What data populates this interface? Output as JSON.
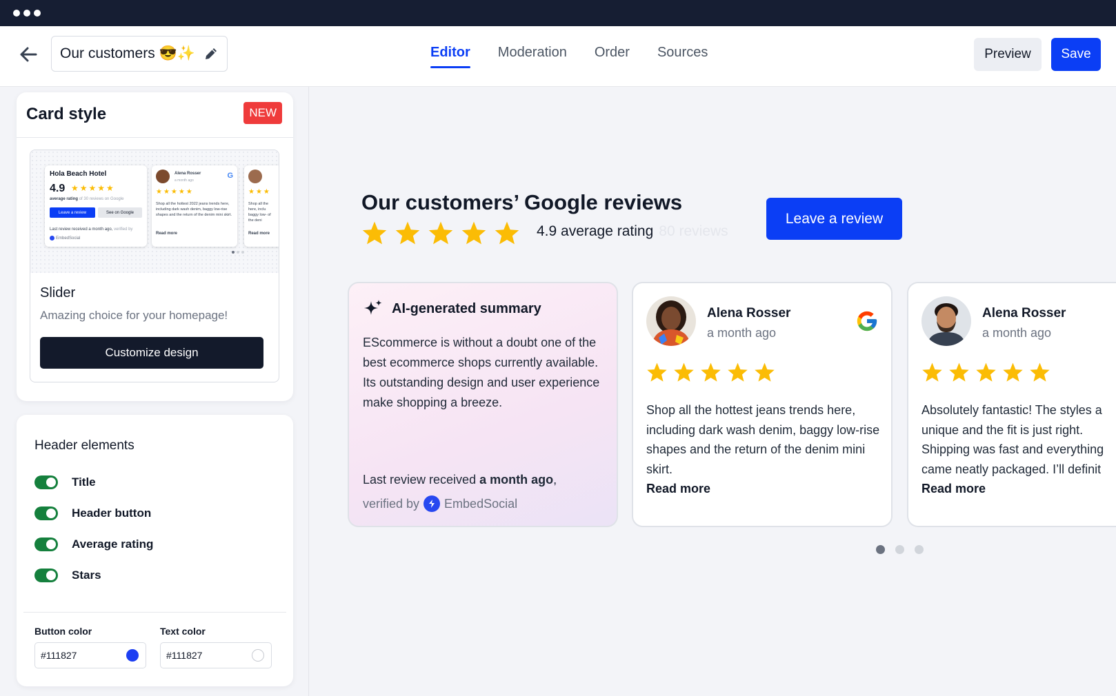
{
  "window": {
    "title_dots": 3
  },
  "topbar": {
    "back_label": "Back",
    "widget_name": "Our customers 😎✨",
    "tabs": [
      {
        "label": "Editor",
        "active": true
      },
      {
        "label": "Moderation",
        "active": false
      },
      {
        "label": "Order",
        "active": false
      },
      {
        "label": "Sources",
        "active": false
      }
    ],
    "preview_label": "Preview",
    "save_label": "Save"
  },
  "sidebar": {
    "card_style": {
      "heading": "Card style",
      "badge": "NEW",
      "thumbnail": {
        "hotel_name": "Hola Beach Hotel",
        "rating": "4.9",
        "rating_caption": "average rating",
        "rating_sub": "of 30 reviews on Google",
        "leave_btn": "Leave a review",
        "see_btn": "See on Google",
        "last_review": "Last review received a month ago,",
        "verified": "verified by",
        "brand": "EmbedSocial",
        "reviewer": "Alena Rosser",
        "reviewer_time": "a month ago",
        "review_snippet": "Shop all the hottest 2022 jeans trends here, including dark wash denim, baggy low-rise shapes and the return of the denim mini skirt.",
        "read_more": "Read more",
        "review_snippet_2": "Shop all the here, inclu baggy low- of the deni"
      },
      "style_name": "Slider",
      "style_desc": "Amazing choice for your homepage!",
      "customize_label": "Customize design"
    },
    "header_elements": {
      "heading": "Header elements",
      "toggles": [
        {
          "label": "Title",
          "on": true
        },
        {
          "label": "Header button",
          "on": true
        },
        {
          "label": "Average rating",
          "on": true
        },
        {
          "label": "Stars",
          "on": true
        }
      ],
      "button_color_label": "Button color",
      "button_color_value": "#111827",
      "button_color_swatch": "#1d3ff2",
      "text_color_label": "Text color",
      "text_color_value": "#111827",
      "text_color_swatch": "#ffffff"
    }
  },
  "preview": {
    "title": "Our customers’ Google reviews",
    "stars": 5,
    "rating_text": "4.9 average rating",
    "reviews_count_text": "80 reviews",
    "leave_review_label": "Leave a review",
    "ai_summary": {
      "title": "AI-generated summary",
      "body": "EScommerce is without a doubt one of the best ecommerce shops currently available. Its outstanding design and user experience make shopping a breeze.",
      "last_review_prefix": "Last review received",
      "last_review_time": "a month ago",
      "last_review_suffix": ",",
      "verified_by": "verified by",
      "brand": "EmbedSocial"
    },
    "reviews": [
      {
        "name": "Alena Rosser",
        "time": "a month ago",
        "rating": 5,
        "text": "Shop all the hottest jeans trends here, including dark wash denim, baggy low-rise shapes and the return of the denim mini skirt.",
        "read_more": "Read more",
        "source_icon": "google-icon"
      },
      {
        "name": "Alena Rosser",
        "time": "a month ago",
        "rating": 5,
        "text_lines": [
          "Absolutely fantastic! The styles a",
          "unique and the fit is just right.",
          "Shipping was fast and everything",
          "came neatly packaged. I’ll definit"
        ],
        "read_more": "Read more"
      }
    ],
    "pager": {
      "pages": 3,
      "active": 1
    }
  },
  "colors": {
    "brand_blue": "#0b3ef5",
    "dark": "#131a2b",
    "toggle_green": "#15803d",
    "star": "#fbbc05",
    "badge_red": "#ef3b3b"
  }
}
